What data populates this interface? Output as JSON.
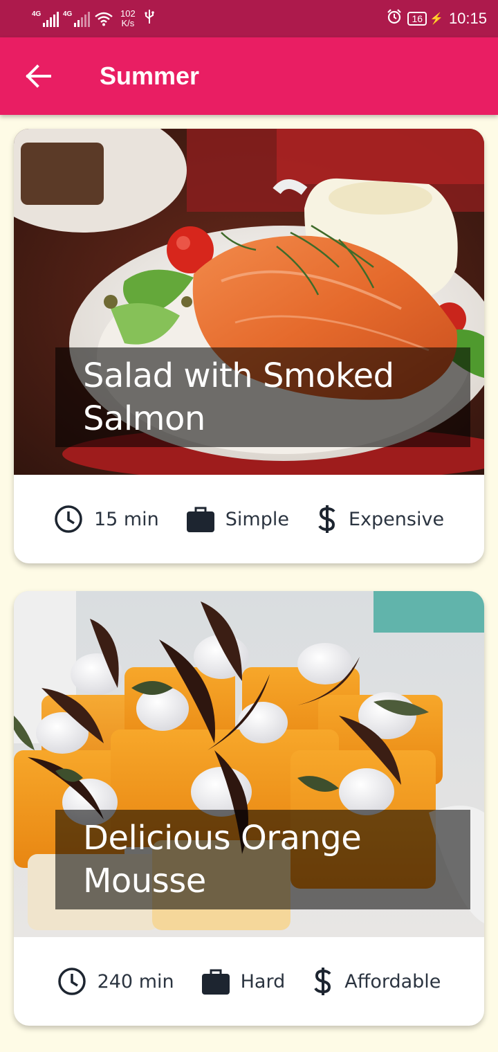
{
  "status_bar": {
    "network_1": "4G",
    "network_2": "4G",
    "speed_value": "102",
    "speed_unit": "K/s",
    "battery": "16",
    "time": "10:15"
  },
  "app_bar": {
    "title": "Summer"
  },
  "recipes": [
    {
      "title": "Salad with Smoked Salmon",
      "duration": "15 min",
      "complexity": "Simple",
      "affordability": "Expensive"
    },
    {
      "title": "Delicious Orange Mousse",
      "duration": "240 min",
      "complexity": "Hard",
      "affordability": "Affordable"
    }
  ],
  "colors": {
    "primary": "#e91e63",
    "status_bar": "#ad1a4c",
    "background": "#fefbe6"
  }
}
